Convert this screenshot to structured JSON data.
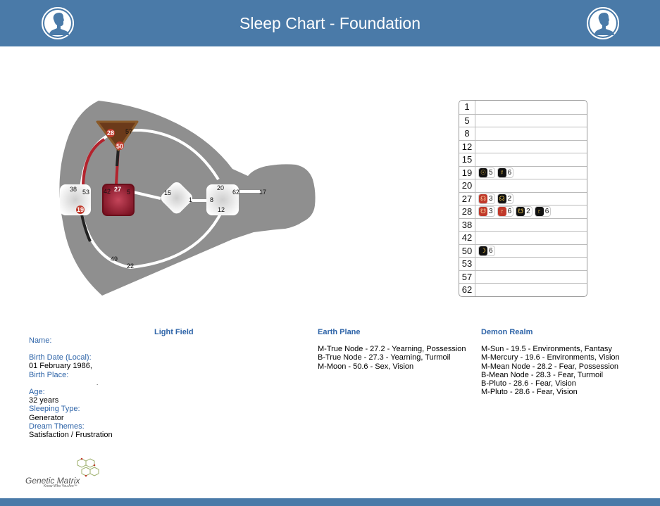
{
  "header": {
    "title": "Sleep Chart - Foundation",
    "left_icon": "person-silhouette-icon",
    "right_icon": "person-silhouette-icon"
  },
  "colors": {
    "header_bg": "#4a7aa8",
    "label_blue": "#2e64a8",
    "body_gray": "#8f8f8f",
    "active_red": "#8b1a2a",
    "active_brown": "#6b3a1a"
  },
  "bodygraph": {
    "gates": {
      "g28": "28",
      "g57": "57",
      "g50": "50",
      "g38": "38",
      "g53": "53",
      "g19": "19",
      "g42": "42",
      "g27": "27",
      "g5": "5",
      "g15": "15",
      "g1": "1",
      "g20": "20",
      "g62": "62",
      "g17": "17",
      "g8": "8",
      "g12": "12",
      "g49": "49",
      "g22": "22"
    }
  },
  "gate_table": {
    "rows": [
      {
        "gate": "1",
        "planets": []
      },
      {
        "gate": "5",
        "planets": []
      },
      {
        "gate": "8",
        "planets": []
      },
      {
        "gate": "12",
        "planets": []
      },
      {
        "gate": "15",
        "planets": []
      },
      {
        "gate": "19",
        "planets": [
          {
            "glyph": "☉",
            "color": "black",
            "line": "5"
          },
          {
            "glyph": "☿",
            "color": "black",
            "line": "6"
          }
        ]
      },
      {
        "gate": "20",
        "planets": []
      },
      {
        "gate": "27",
        "planets": [
          {
            "glyph": "☊",
            "color": "red",
            "line": "3"
          },
          {
            "glyph": "☊",
            "color": "black",
            "line": "2"
          }
        ]
      },
      {
        "gate": "28",
        "planets": [
          {
            "glyph": "☋",
            "color": "red",
            "line": "3"
          },
          {
            "glyph": "♇",
            "color": "red",
            "line": "6"
          },
          {
            "glyph": "☋",
            "color": "black",
            "line": "2"
          },
          {
            "glyph": "♇",
            "color": "black",
            "line": "6"
          }
        ]
      },
      {
        "gate": "38",
        "planets": []
      },
      {
        "gate": "42",
        "planets": []
      },
      {
        "gate": "50",
        "planets": [
          {
            "glyph": "☽",
            "color": "black",
            "line": "6"
          }
        ]
      },
      {
        "gate": "53",
        "planets": []
      },
      {
        "gate": "57",
        "planets": []
      },
      {
        "gate": "62",
        "planets": []
      }
    ]
  },
  "light_field": {
    "title": "Light Field",
    "name_label": "Name:",
    "name_value": "",
    "birth_date_label": "Birth Date (Local):",
    "birth_date_value": "01 February 1986,",
    "birth_place_label": "Birth Place:",
    "birth_place_value": ".",
    "age_label": "Age:",
    "age_value": "32 years",
    "sleeping_type_label": "Sleeping Type:",
    "sleeping_type_value": "Generator",
    "dream_themes_label": "Dream Themes:",
    "dream_themes_value": "Satisfaction / Frustration"
  },
  "earth_plane": {
    "title": "Earth Plane",
    "items": [
      "M-True Node - 27.2 - Yearning, Possession",
      "B-True Node - 27.3 - Yearning, Turmoil",
      "M-Moon - 50.6 - Sex, Vision"
    ]
  },
  "demon_realm": {
    "title": "Demon Realm",
    "items": [
      "M-Sun - 19.5 - Environments, Fantasy",
      "M-Mercury - 19.6 - Environments, Vision",
      "M-Mean Node - 28.2 - Fear, Possession",
      "B-Mean Node - 28.3 - Fear, Turmoil",
      "B-Pluto - 28.6 - Fear, Vision",
      "M-Pluto - 28.6 - Fear, Vision"
    ]
  },
  "footer": {
    "logo_text": "Genetic Matrix",
    "logo_tagline": "Know Who You Are™"
  }
}
